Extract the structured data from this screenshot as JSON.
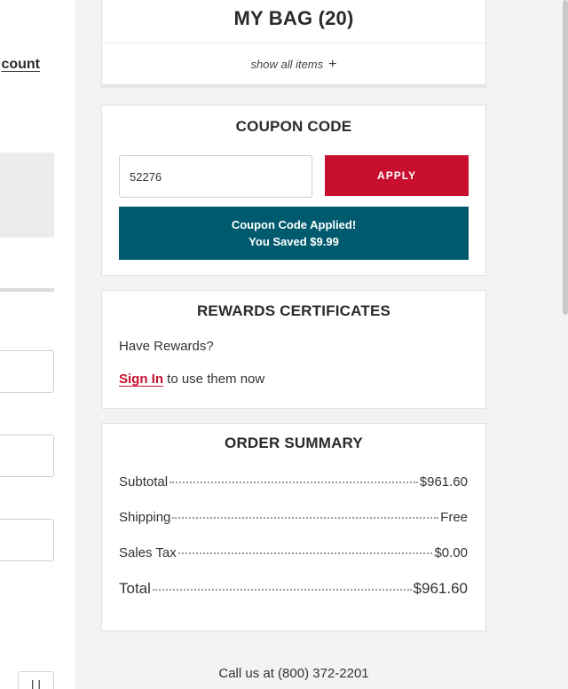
{
  "left_pane": {
    "account_link": "count",
    "stepper_label": "| |"
  },
  "bag": {
    "title": "MY BAG (20)",
    "show_all_label": "show all items",
    "plus_glyph": "+"
  },
  "coupon": {
    "title": "COUPON CODE",
    "input_value": "52276",
    "apply_label": "APPLY",
    "applied_line1": "Coupon Code Applied!",
    "applied_line2": "You Saved $9.99"
  },
  "rewards": {
    "title": "REWARDS CERTIFICATES",
    "have_rewards": "Have Rewards?",
    "sign_in_label": "Sign In",
    "sign_in_suffix": " to use them now"
  },
  "summary": {
    "title": "ORDER SUMMARY",
    "rows": [
      {
        "label": "Subtotal",
        "value": "$961.60"
      },
      {
        "label": "Shipping",
        "value": "Free"
      },
      {
        "label": "Sales Tax",
        "value": "$0.00"
      },
      {
        "label": "Total",
        "value": "$961.60"
      }
    ]
  },
  "footer": {
    "call_us": "Call us at (800) 372-2201"
  },
  "colors": {
    "accent_red": "#c8102e",
    "applied_teal": "#005a6e"
  }
}
